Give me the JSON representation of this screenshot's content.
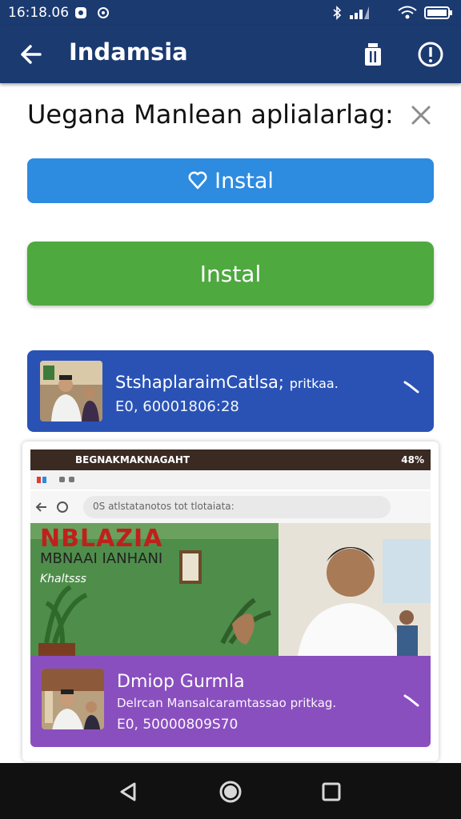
{
  "status_bar": {
    "time": "16:18.06",
    "icons": [
      "notification-icon",
      "alarm-icon",
      "bluetooth-icon",
      "signal-icon",
      "wifi-icon",
      "battery-icon"
    ]
  },
  "app_bar": {
    "title": "Indamsia",
    "icons": [
      "back-arrow-icon",
      "trash-icon",
      "info-icon"
    ]
  },
  "dialog": {
    "heading": "Uegana Manlean aplialarlag:",
    "close_icon": "close-icon",
    "install_blue_label": "Instal",
    "install_green_label": "Instal"
  },
  "cards": [
    {
      "title": "StshaplaraimCatlsa;",
      "title_suffix": "pritkaa.",
      "subtitle": "E0, 60001806:28",
      "accent": "#2a52b5"
    },
    {
      "title": "Dmiop Gurmla",
      "description": "Delrcan Mansalcaramtassao pritkag.",
      "subtitle": "E0, 50000809S70",
      "accent": "#8a4fbf"
    }
  ],
  "embedded_screenshot": {
    "status_text": "BEGNAKMAKNAGAHT",
    "status_right": "48%",
    "url_text": "0S atlstatanotos tot tlotaiata:",
    "hero_title": "NBLAZIA",
    "hero_subtitle": "MBNAAI IANHANI",
    "hero_caption": "Khaltsss"
  },
  "nav_bar": {
    "icons": [
      "back-triangle-icon",
      "home-circle-icon",
      "recents-square-icon"
    ]
  },
  "colors": {
    "app_bar": "#1b3a70",
    "install_blue": "#2d8be0",
    "install_green": "#4ea93f"
  }
}
